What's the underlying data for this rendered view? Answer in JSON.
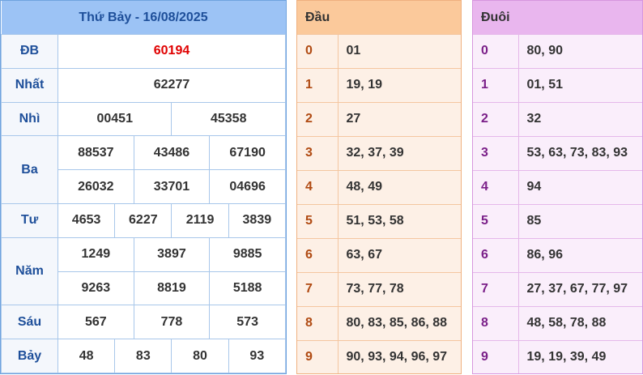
{
  "results": {
    "title": "Thứ Bảy - 16/08/2025",
    "prizes": {
      "db": {
        "label": "ĐB",
        "numbers": [
          "60194"
        ]
      },
      "nhat": {
        "label": "Nhất",
        "numbers": [
          "62277"
        ]
      },
      "nhi": {
        "label": "Nhì",
        "numbers": [
          "00451",
          "45358"
        ]
      },
      "ba": {
        "label": "Ba",
        "numbers": [
          "88537",
          "43486",
          "67190",
          "26032",
          "33701",
          "04696"
        ]
      },
      "tu": {
        "label": "Tư",
        "numbers": [
          "4653",
          "6227",
          "2119",
          "3839"
        ]
      },
      "nam": {
        "label": "Năm",
        "numbers": [
          "1249",
          "3897",
          "9885",
          "9263",
          "8819",
          "5188"
        ]
      },
      "sau": {
        "label": "Sáu",
        "numbers": [
          "567",
          "778",
          "573"
        ]
      },
      "bay": {
        "label": "Bảy",
        "numbers": [
          "48",
          "83",
          "80",
          "93"
        ]
      }
    }
  },
  "head": {
    "title": "Đầu",
    "rows": [
      {
        "digit": "0",
        "values": "01"
      },
      {
        "digit": "1",
        "values": "19, 19"
      },
      {
        "digit": "2",
        "values": "27"
      },
      {
        "digit": "3",
        "values": "32, 37, 39"
      },
      {
        "digit": "4",
        "values": "48, 49"
      },
      {
        "digit": "5",
        "values": "51, 53, 58"
      },
      {
        "digit": "6",
        "values": "63, 67"
      },
      {
        "digit": "7",
        "values": "73, 77, 78"
      },
      {
        "digit": "8",
        "values": "80, 83, 85, 86, 88"
      },
      {
        "digit": "9",
        "values": "90, 93, 94, 96, 97"
      }
    ]
  },
  "tail": {
    "title": "Đuôi",
    "rows": [
      {
        "digit": "0",
        "values": "80, 90"
      },
      {
        "digit": "1",
        "values": "01, 51"
      },
      {
        "digit": "2",
        "values": "32"
      },
      {
        "digit": "3",
        "values": "53, 63, 73, 83, 93"
      },
      {
        "digit": "4",
        "values": "94"
      },
      {
        "digit": "5",
        "values": "85"
      },
      {
        "digit": "6",
        "values": "86, 96"
      },
      {
        "digit": "7",
        "values": "27, 37, 67, 77, 97"
      },
      {
        "digit": "8",
        "values": "48, 58, 78, 88"
      },
      {
        "digit": "9",
        "values": "19, 19, 39, 49"
      }
    ]
  },
  "colors": {
    "special_prize": "#e00000",
    "results_header": "#9cc3f5",
    "head_header": "#fbc99b",
    "tail_header": "#e9b6ee"
  }
}
